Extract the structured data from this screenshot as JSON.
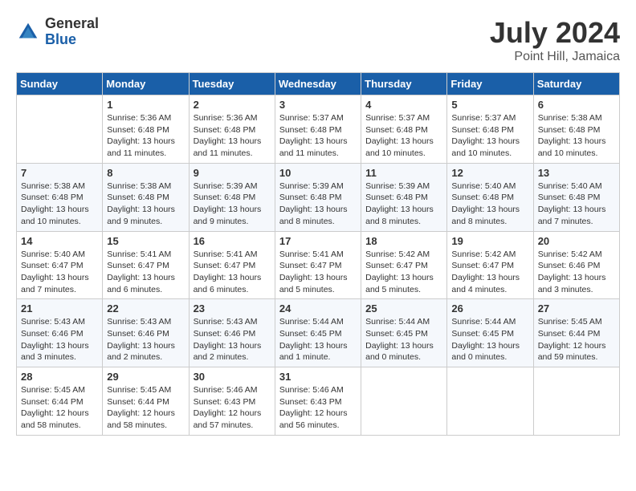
{
  "header": {
    "logo_general": "General",
    "logo_blue": "Blue",
    "title": "July 2024",
    "location": "Point Hill, Jamaica"
  },
  "calendar": {
    "days_of_week": [
      "Sunday",
      "Monday",
      "Tuesday",
      "Wednesday",
      "Thursday",
      "Friday",
      "Saturday"
    ],
    "weeks": [
      [
        {
          "day": "",
          "sunrise": "",
          "sunset": "",
          "daylight": "",
          "empty": true
        },
        {
          "day": "1",
          "sunrise": "Sunrise: 5:36 AM",
          "sunset": "Sunset: 6:48 PM",
          "daylight": "Daylight: 13 hours and 11 minutes."
        },
        {
          "day": "2",
          "sunrise": "Sunrise: 5:36 AM",
          "sunset": "Sunset: 6:48 PM",
          "daylight": "Daylight: 13 hours and 11 minutes."
        },
        {
          "day": "3",
          "sunrise": "Sunrise: 5:37 AM",
          "sunset": "Sunset: 6:48 PM",
          "daylight": "Daylight: 13 hours and 11 minutes."
        },
        {
          "day": "4",
          "sunrise": "Sunrise: 5:37 AM",
          "sunset": "Sunset: 6:48 PM",
          "daylight": "Daylight: 13 hours and 10 minutes."
        },
        {
          "day": "5",
          "sunrise": "Sunrise: 5:37 AM",
          "sunset": "Sunset: 6:48 PM",
          "daylight": "Daylight: 13 hours and 10 minutes."
        },
        {
          "day": "6",
          "sunrise": "Sunrise: 5:38 AM",
          "sunset": "Sunset: 6:48 PM",
          "daylight": "Daylight: 13 hours and 10 minutes."
        }
      ],
      [
        {
          "day": "7",
          "sunrise": "Sunrise: 5:38 AM",
          "sunset": "Sunset: 6:48 PM",
          "daylight": "Daylight: 13 hours and 10 minutes."
        },
        {
          "day": "8",
          "sunrise": "Sunrise: 5:38 AM",
          "sunset": "Sunset: 6:48 PM",
          "daylight": "Daylight: 13 hours and 9 minutes."
        },
        {
          "day": "9",
          "sunrise": "Sunrise: 5:39 AM",
          "sunset": "Sunset: 6:48 PM",
          "daylight": "Daylight: 13 hours and 9 minutes."
        },
        {
          "day": "10",
          "sunrise": "Sunrise: 5:39 AM",
          "sunset": "Sunset: 6:48 PM",
          "daylight": "Daylight: 13 hours and 8 minutes."
        },
        {
          "day": "11",
          "sunrise": "Sunrise: 5:39 AM",
          "sunset": "Sunset: 6:48 PM",
          "daylight": "Daylight: 13 hours and 8 minutes."
        },
        {
          "day": "12",
          "sunrise": "Sunrise: 5:40 AM",
          "sunset": "Sunset: 6:48 PM",
          "daylight": "Daylight: 13 hours and 8 minutes."
        },
        {
          "day": "13",
          "sunrise": "Sunrise: 5:40 AM",
          "sunset": "Sunset: 6:48 PM",
          "daylight": "Daylight: 13 hours and 7 minutes."
        }
      ],
      [
        {
          "day": "14",
          "sunrise": "Sunrise: 5:40 AM",
          "sunset": "Sunset: 6:47 PM",
          "daylight": "Daylight: 13 hours and 7 minutes."
        },
        {
          "day": "15",
          "sunrise": "Sunrise: 5:41 AM",
          "sunset": "Sunset: 6:47 PM",
          "daylight": "Daylight: 13 hours and 6 minutes."
        },
        {
          "day": "16",
          "sunrise": "Sunrise: 5:41 AM",
          "sunset": "Sunset: 6:47 PM",
          "daylight": "Daylight: 13 hours and 6 minutes."
        },
        {
          "day": "17",
          "sunrise": "Sunrise: 5:41 AM",
          "sunset": "Sunset: 6:47 PM",
          "daylight": "Daylight: 13 hours and 5 minutes."
        },
        {
          "day": "18",
          "sunrise": "Sunrise: 5:42 AM",
          "sunset": "Sunset: 6:47 PM",
          "daylight": "Daylight: 13 hours and 5 minutes."
        },
        {
          "day": "19",
          "sunrise": "Sunrise: 5:42 AM",
          "sunset": "Sunset: 6:47 PM",
          "daylight": "Daylight: 13 hours and 4 minutes."
        },
        {
          "day": "20",
          "sunrise": "Sunrise: 5:42 AM",
          "sunset": "Sunset: 6:46 PM",
          "daylight": "Daylight: 13 hours and 3 minutes."
        }
      ],
      [
        {
          "day": "21",
          "sunrise": "Sunrise: 5:43 AM",
          "sunset": "Sunset: 6:46 PM",
          "daylight": "Daylight: 13 hours and 3 minutes."
        },
        {
          "day": "22",
          "sunrise": "Sunrise: 5:43 AM",
          "sunset": "Sunset: 6:46 PM",
          "daylight": "Daylight: 13 hours and 2 minutes."
        },
        {
          "day": "23",
          "sunrise": "Sunrise: 5:43 AM",
          "sunset": "Sunset: 6:46 PM",
          "daylight": "Daylight: 13 hours and 2 minutes."
        },
        {
          "day": "24",
          "sunrise": "Sunrise: 5:44 AM",
          "sunset": "Sunset: 6:45 PM",
          "daylight": "Daylight: 13 hours and 1 minute."
        },
        {
          "day": "25",
          "sunrise": "Sunrise: 5:44 AM",
          "sunset": "Sunset: 6:45 PM",
          "daylight": "Daylight: 13 hours and 0 minutes."
        },
        {
          "day": "26",
          "sunrise": "Sunrise: 5:44 AM",
          "sunset": "Sunset: 6:45 PM",
          "daylight": "Daylight: 13 hours and 0 minutes."
        },
        {
          "day": "27",
          "sunrise": "Sunrise: 5:45 AM",
          "sunset": "Sunset: 6:44 PM",
          "daylight": "Daylight: 12 hours and 59 minutes."
        }
      ],
      [
        {
          "day": "28",
          "sunrise": "Sunrise: 5:45 AM",
          "sunset": "Sunset: 6:44 PM",
          "daylight": "Daylight: 12 hours and 58 minutes."
        },
        {
          "day": "29",
          "sunrise": "Sunrise: 5:45 AM",
          "sunset": "Sunset: 6:44 PM",
          "daylight": "Daylight: 12 hours and 58 minutes."
        },
        {
          "day": "30",
          "sunrise": "Sunrise: 5:46 AM",
          "sunset": "Sunset: 6:43 PM",
          "daylight": "Daylight: 12 hours and 57 minutes."
        },
        {
          "day": "31",
          "sunrise": "Sunrise: 5:46 AM",
          "sunset": "Sunset: 6:43 PM",
          "daylight": "Daylight: 12 hours and 56 minutes."
        },
        {
          "day": "",
          "sunrise": "",
          "sunset": "",
          "daylight": "",
          "empty": true
        },
        {
          "day": "",
          "sunrise": "",
          "sunset": "",
          "daylight": "",
          "empty": true
        },
        {
          "day": "",
          "sunrise": "",
          "sunset": "",
          "daylight": "",
          "empty": true
        }
      ]
    ]
  }
}
